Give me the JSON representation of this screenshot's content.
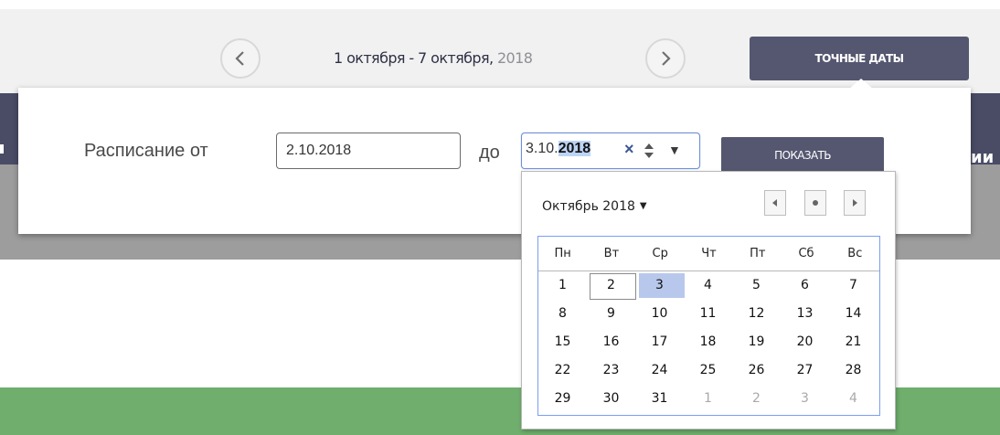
{
  "header": {
    "week_range": "1 октября - 7 октября,",
    "year": "2018",
    "exact_dates_label": "ТОЧНЫЕ ДАТЫ",
    "prev_icon": "chevron-left-icon",
    "next_icon": "chevron-right-icon"
  },
  "background": {
    "right_text": "ии"
  },
  "filter": {
    "from_label": "Расписание от",
    "from_value": "2.10.2018",
    "to_label": "до",
    "to_value_prefix": "3.10.",
    "to_value_selected": "2018",
    "clear_icon": "×",
    "dropdown_icon": "▼",
    "show_label": "ПОКАЗАТЬ"
  },
  "datepicker": {
    "month_label": "Октябрь 2018",
    "month_caret": "▼",
    "weekdays": [
      "Пн",
      "Вт",
      "Ср",
      "Чт",
      "Пт",
      "Сб",
      "Вс"
    ],
    "weeks": [
      [
        "1",
        "2",
        "3",
        "4",
        "5",
        "6",
        "7"
      ],
      [
        "8",
        "9",
        "10",
        "11",
        "12",
        "13",
        "14"
      ],
      [
        "15",
        "16",
        "17",
        "18",
        "19",
        "20",
        "21"
      ],
      [
        "22",
        "23",
        "24",
        "25",
        "26",
        "27",
        "28"
      ],
      [
        "29",
        "30",
        "31",
        "1",
        "2",
        "3",
        "4"
      ]
    ],
    "today": "2",
    "selected": "3"
  },
  "colors": {
    "accent": "#555770",
    "selection": "#b8c8ec",
    "header_bg": "#f1f1f1",
    "band_dark": "#4a4c66",
    "band_gray": "#9d9d9d",
    "band_green": "#6fae6c"
  }
}
